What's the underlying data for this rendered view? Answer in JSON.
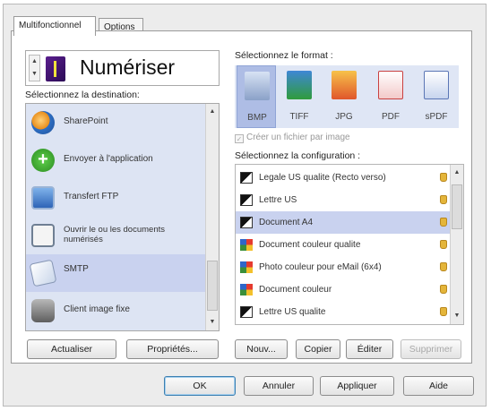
{
  "tabs": [
    {
      "label": "Multifonctionnel",
      "active": true
    },
    {
      "label": "Options",
      "active": false
    }
  ],
  "header": {
    "title": "Numériser"
  },
  "destination": {
    "label": "Sélectionnez la destination:",
    "items": [
      {
        "label": "SharePoint",
        "icon": "sharepoint-icon"
      },
      {
        "label": "Envoyer à l'application",
        "icon": "add-application-icon"
      },
      {
        "label": "Transfert FTP",
        "icon": "ftp-transfer-icon"
      },
      {
        "label": "Ouvrir le ou les documents numérisés",
        "icon": "open-document-icon"
      },
      {
        "label": "SMTP",
        "icon": "smtp-mail-icon",
        "selected": true
      },
      {
        "label": "Client image fixe",
        "icon": "still-image-client-icon"
      }
    ]
  },
  "format": {
    "label": "Sélectionnez le format :",
    "items": [
      {
        "label": "BMP",
        "selected": true
      },
      {
        "label": "TIFF"
      },
      {
        "label": "JPG"
      },
      {
        "label": "PDF"
      },
      {
        "label": "sPDF"
      }
    ],
    "checkbox_label": "Créer un fichier par image"
  },
  "configuration": {
    "label": "Sélectionnez la configuration :",
    "items": [
      {
        "label": "Legale US qualite (Recto verso)",
        "icon": "bw-document-icon"
      },
      {
        "label": "Lettre US",
        "icon": "bw-document-icon"
      },
      {
        "label": "Document A4",
        "icon": "bw-document-icon",
        "selected": true
      },
      {
        "label": "Document couleur qualite",
        "icon": "color-document-icon"
      },
      {
        "label": "Photo couleur pour eMail (6x4)",
        "icon": "color-document-icon"
      },
      {
        "label": "Document couleur",
        "icon": "color-document-icon"
      },
      {
        "label": "Lettre US qualite",
        "icon": "bw-document-icon"
      }
    ]
  },
  "buttons": {
    "refresh": "Actualiser",
    "properties": "Propriétés...",
    "new": "Nouv...",
    "copy": "Copier",
    "edit": "Éditer",
    "delete": "Supprimer",
    "ok": "OK",
    "cancel": "Annuler",
    "apply": "Appliquer",
    "help": "Aide"
  },
  "colors": {
    "selection": "#c9d2ef",
    "list_background": "#dde4f3",
    "format_background": "#dfe6f5"
  }
}
